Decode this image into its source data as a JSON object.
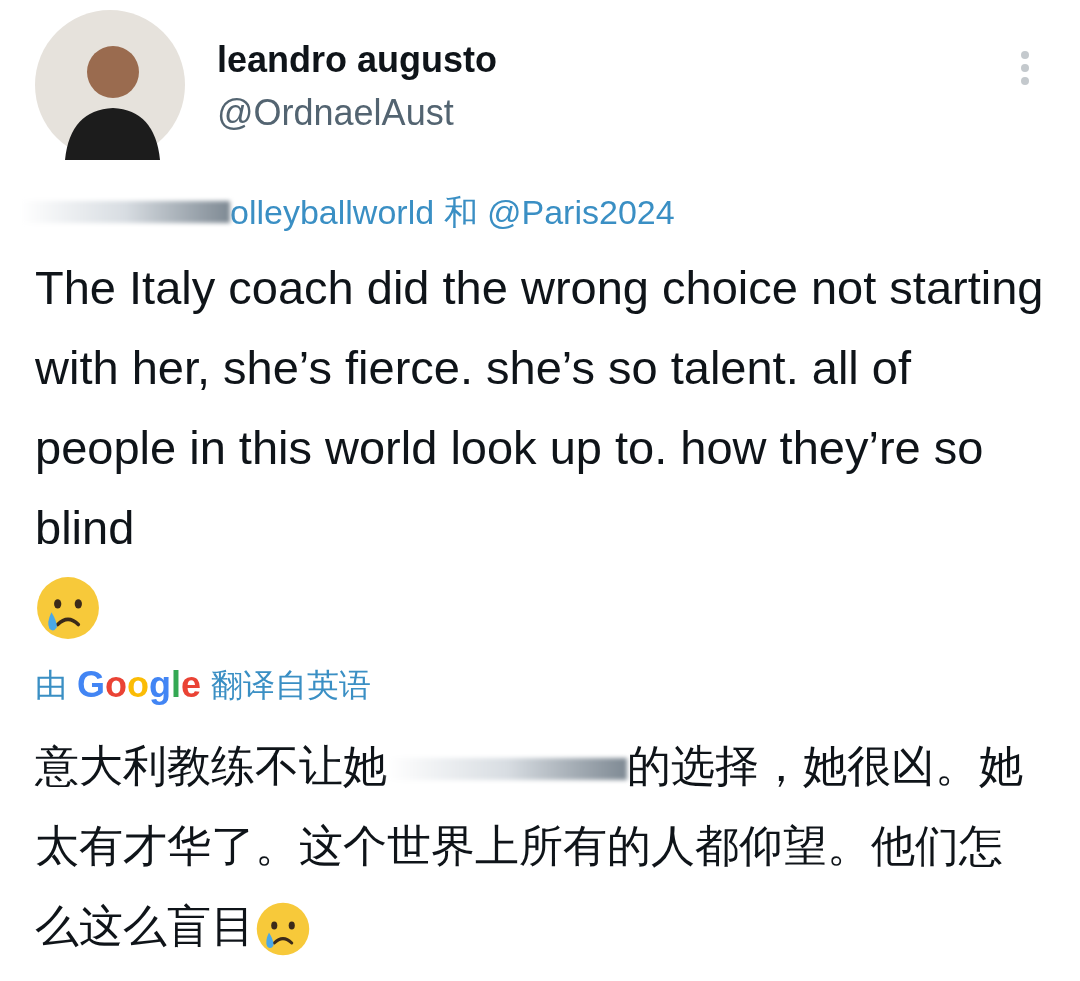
{
  "author": {
    "name": "leandro augusto",
    "handle": "@OrdnaelAust"
  },
  "replying_to": {
    "mentions": "olleyballworld 和 @Paris2024"
  },
  "tweet_text": "The Italy coach did the wrong choice not starting with her, she’s fierce. she’s so talent. all of people in this world look up to. how they’re so blind",
  "translation_label": {
    "prefix": "由",
    "brand": "Google",
    "suffix": "翻译自英语"
  },
  "translation": {
    "before": "意大利教练不让她",
    "after": "的选择，她很凶。她太有才华了。这个世界上所有的人都仰望。他们怎么这么盲目"
  }
}
